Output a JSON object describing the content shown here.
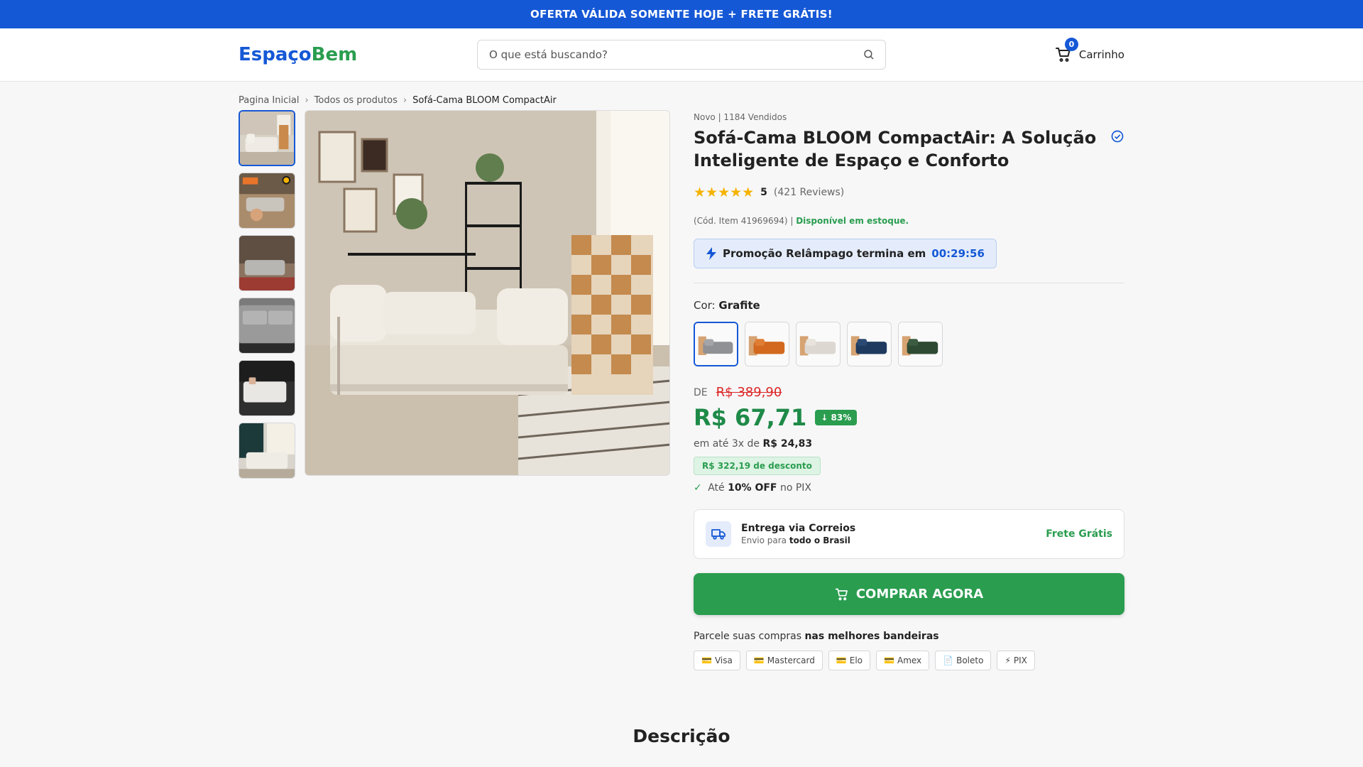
{
  "promo_bar": "OFERTA VÁLIDA SOMENTE HOJE + FRETE GRÁTIS!",
  "logo": {
    "part1": "Espaço",
    "part2": "Bem"
  },
  "search": {
    "placeholder": "O que está buscando?",
    "icon": "search-icon"
  },
  "cart": {
    "label": "Carrinho",
    "count": "0",
    "icon": "cart-icon"
  },
  "breadcrumb": [
    "Pagina Inicial",
    "Todos os produtos",
    "Sofá-Cama BLOOM CompactAir"
  ],
  "product": {
    "meta": "Novo | 1184 Vendidos",
    "title": "Sofá-Cama BLOOM CompactAir: A Solução Inteligente de Espaço e Conforto",
    "rating_score": "5",
    "rating_reviews": "(421 Reviews)",
    "stock_code": "(Cód. Item 41969694) | ",
    "stock_status": "Disponível em estoque.",
    "flash_label": "Promoção Relâmpago termina em",
    "flash_timer": "00:29:56",
    "color_label": "Cor:",
    "color_selected": "Grafite",
    "colors": [
      {
        "hex": "#8f9194"
      },
      {
        "hex": "#d2691e"
      },
      {
        "hex": "#dcd8d1"
      },
      {
        "hex": "#1e3a5f"
      },
      {
        "hex": "#2e4a33"
      }
    ],
    "price_prefix": "DE",
    "price_old": "R$ 389,90",
    "price_now": "R$ 67,71",
    "discount_pct": "↓ 83%",
    "installment_prefix": "em até 3x de",
    "installment_value": "R$ 24,83",
    "discount_amount": "R$ 322,19 de desconto",
    "pix_prefix": "Até",
    "pix_bold": "10% OFF",
    "pix_suffix": "no PIX"
  },
  "delivery": {
    "title": "Entrega via Correios",
    "subtitle_prefix": "Envio para",
    "subtitle_bold": "todo o Brasil",
    "free": "Frete Grátis"
  },
  "buy_button": "COMPRAR AGORA",
  "parcel": {
    "prefix": "Parcele suas compras",
    "bold": "nas melhores bandeiras"
  },
  "payments": [
    {
      "icon": "💳",
      "label": "Visa"
    },
    {
      "icon": "💳",
      "label": "Mastercard"
    },
    {
      "icon": "💳",
      "label": "Elo"
    },
    {
      "icon": "💳",
      "label": "Amex"
    },
    {
      "icon": "📄",
      "label": "Boleto"
    },
    {
      "icon": "⚡",
      "label": "PIX"
    }
  ],
  "description_title": "Descrição",
  "colors": {
    "primary": "#1558d6",
    "success": "#2a9d4f",
    "danger": "#dc2626",
    "star": "#f5b300"
  }
}
